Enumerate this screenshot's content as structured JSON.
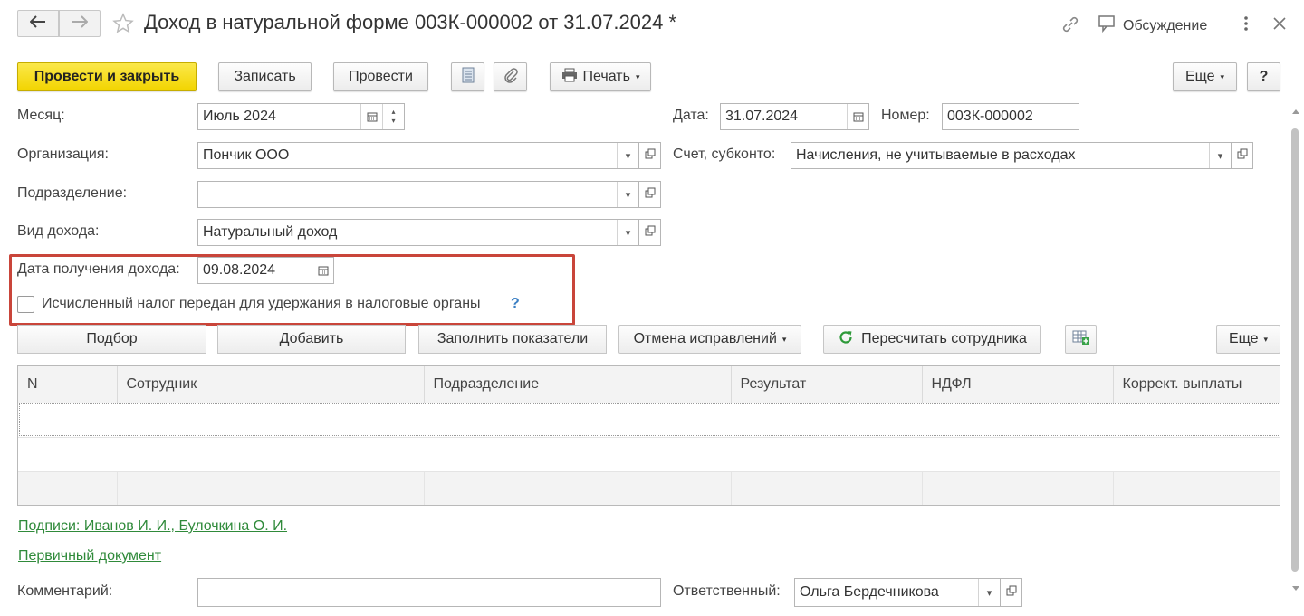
{
  "window": {
    "title": "Доход в натуральной форме 003К-000002 от 31.07.2024 *",
    "discussion_label": "Обсуждение"
  },
  "toolbar": {
    "post_close_label": "Провести и закрыть",
    "save_label": "Записать",
    "post_label": "Провести",
    "print_label": "Печать",
    "more_label": "Еще",
    "help_label": "?"
  },
  "form": {
    "month_label": "Месяц:",
    "month_value": "Июль 2024",
    "date_label": "Дата:",
    "date_value": "31.07.2024",
    "number_label": "Номер:",
    "number_value": "003К-000002",
    "org_label": "Организация:",
    "org_value": "Пончик ООО",
    "account_label": "Счет, субконто:",
    "account_value": "Начисления, не учитываемые в расходах",
    "division_label": "Подразделение:",
    "division_value": "",
    "income_type_label": "Вид дохода:",
    "income_type_value": "Натуральный доход",
    "income_date_label": "Дата получения дохода:",
    "income_date_value": "09.08.2024",
    "tax_checkbox_label": "Исчисленный налог передан для удержания в налоговые органы",
    "help_mark": "?"
  },
  "table_toolbar": {
    "select_label": "Подбор",
    "add_label": "Добавить",
    "fill_label": "Заполнить показатели",
    "cancel_fix_label": "Отмена исправлений",
    "recalc_label": "Пересчитать сотрудника",
    "more_label": "Еще"
  },
  "table": {
    "columns": [
      "N",
      "Сотрудник",
      "Подразделение",
      "Результат",
      "НДФЛ",
      "Коррект. выплаты"
    ]
  },
  "footer": {
    "signatures_link": "Подписи: Иванов И. И., Булочкина О. И.",
    "primary_doc_link": "Первичный документ",
    "comment_label": "Комментарий:",
    "comment_value": "",
    "responsible_label": "Ответственный:",
    "responsible_value": "Ольга Бердечникова"
  },
  "colors": {
    "primary_button": "#f2d400",
    "link": "#2f8a3a",
    "highlight_frame": "#c9453a"
  }
}
